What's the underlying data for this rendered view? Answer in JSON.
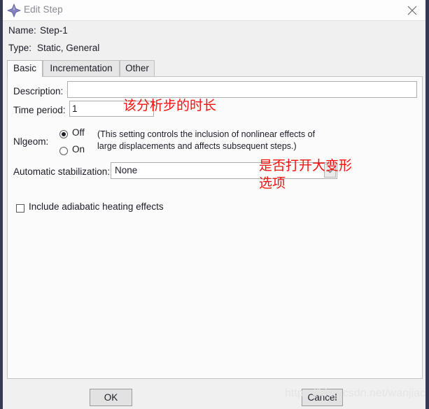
{
  "window": {
    "title": "Edit Step",
    "icon": "abaqus-diamond-icon",
    "close_icon": "close-icon",
    "frame_color": "#343a52"
  },
  "header": {
    "name_label": "Name:",
    "name_value": "Step-1",
    "type_label": "Type:",
    "type_value": "Static, General"
  },
  "tabs": [
    {
      "label": "Basic",
      "active": true
    },
    {
      "label": "Incrementation",
      "active": false
    },
    {
      "label": "Other",
      "active": false
    }
  ],
  "form": {
    "description": {
      "label": "Description:",
      "value": "",
      "placeholder": ""
    },
    "time_period": {
      "label": "Time period:",
      "value": "1"
    },
    "nlgeom": {
      "label": "Nlgeom:",
      "options": [
        {
          "label": "Off",
          "selected": true
        },
        {
          "label": "On",
          "selected": false
        }
      ],
      "hint": "(This setting controls the inclusion of nonlinear effects of large displacements and affects subsequent steps.)"
    },
    "automatic_stabilization": {
      "label": "Automatic stabilization:",
      "value": "None",
      "arrow_icon": "chevron-down-icon"
    },
    "adiabatic": {
      "label": "Include adiabatic heating effects",
      "checked": false
    }
  },
  "annotations": {
    "time_period_note": "该分析步的时长",
    "automatic_stabilization_note": "是否打开大变形\n选项",
    "color": "#f5110e"
  },
  "footer": {
    "ok_label": "OK",
    "cancel_label": "Cancel"
  },
  "watermark": {
    "text": "https://blog.csdn.net/wanjiac"
  }
}
